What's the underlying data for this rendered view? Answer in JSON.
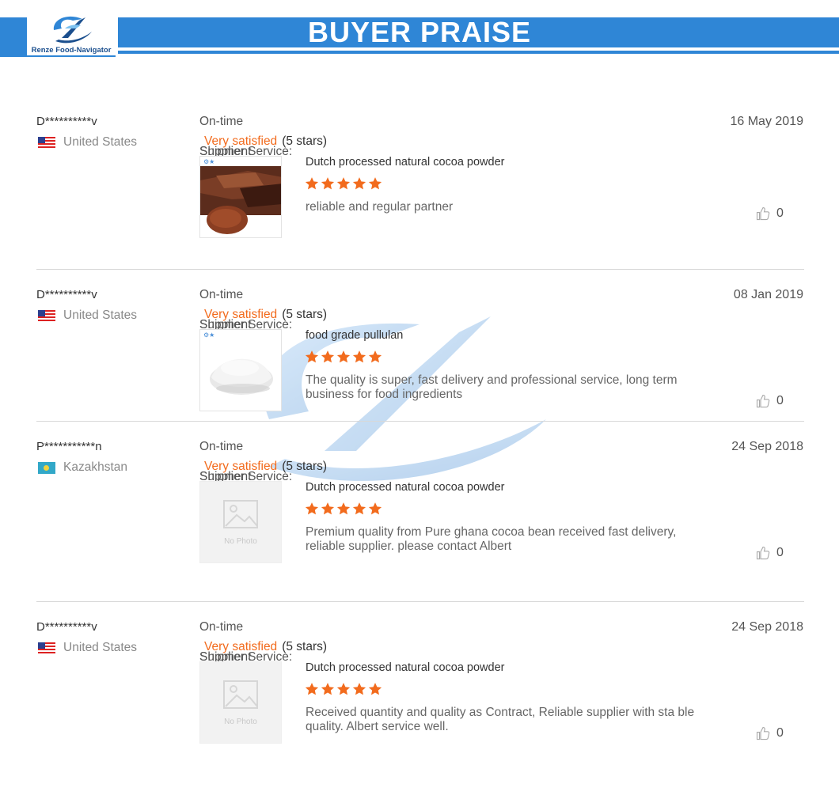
{
  "header": {
    "logo_text": "Renze Food-Navigator",
    "title": "BUYER PRAISE",
    "accent_color": "#2f86d6"
  },
  "labels": {
    "on_time": "On-time",
    "shipment": "Shipment",
    "supplier_service": "Supplier Service:",
    "rating_text": "Very satisfied",
    "rating_stars": "(5 stars)",
    "no_photo": "No Photo"
  },
  "reviews": [
    {
      "buyer": "D**********v",
      "country": "United States",
      "flag": "us-flag",
      "date": "16 May 2019",
      "product": "Dutch processed natural cocoa powder",
      "stars": 5,
      "comment": "reliable and regular partner",
      "likes": "0",
      "image": "cocoa-photo"
    },
    {
      "buyer": "D**********v",
      "country": "United States",
      "flag": "us-flag",
      "date": "08 Jan 2019",
      "product": "food grade pullulan",
      "stars": 5,
      "comment": "The quality is super, fast delivery and professional service, long term business for food ingredients",
      "likes": "0",
      "image": "powder-photo"
    },
    {
      "buyer": "P***********n",
      "country": "Kazakhstan",
      "flag": "kz-flag",
      "date": "24 Sep 2018",
      "product": "Dutch processed natural cocoa powder",
      "stars": 5,
      "comment": "Premium quality from Pure ghana cocoa bean received fast delivery, reliable supplier. please contact Albert",
      "likes": "0",
      "image": "no-photo"
    },
    {
      "buyer": "D**********v",
      "country": "United States",
      "flag": "us-flag",
      "date": "24 Sep 2018",
      "product": "Dutch processed natural cocoa powder",
      "stars": 5,
      "comment": "Received quantity and quality as Contract, Reliable supplier with sta ble quality. Albert service well.",
      "likes": "0",
      "image": "no-photo"
    }
  ]
}
